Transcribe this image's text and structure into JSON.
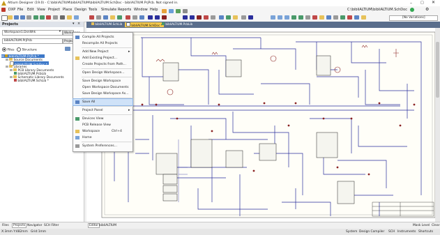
{
  "window": {
    "title": "Altium Designer (19.0) - C:\\bibliALTIUM\\bibliALTIUM\\bibliALTIUM.SchDoc - bibliALTIUM.PrjPcb. Not signed in.",
    "path_readout": "C:\\bibliALTIUM\\bibliALTIUM.SchDoc",
    "variations": "[No Variations]"
  },
  "menubar": {
    "items": [
      "DXP",
      "File",
      "Edit",
      "View",
      "Project",
      "Place",
      "Design",
      "Tools",
      "Simulate",
      "Reports",
      "Window",
      "Help"
    ]
  },
  "projects_panel": {
    "title": "Projects",
    "workspace_value": "Workspace1.DsnWrk",
    "workspace_button": "Workspace",
    "project_value": "bibliALTIUM.PrjPcb",
    "project_button": "Project",
    "radio_files": "Files",
    "radio_structure": "Structure",
    "tree": [
      {
        "label": "bibliALTIUM.PrjPcb *",
        "level": 0,
        "selected": true
      },
      {
        "label": "Source Documents",
        "level": 1,
        "selected": false
      },
      {
        "label": "bibliALTIUM.SchDoc *",
        "level": 2,
        "selected": true
      },
      {
        "label": "Libraries",
        "level": 1,
        "selected": false
      },
      {
        "label": "PCB Library Documents",
        "level": 2,
        "selected": false
      },
      {
        "label": "bibliALTIUM.PcbLib",
        "level": 3,
        "selected": false
      },
      {
        "label": "Schematic Library Documents",
        "level": 2,
        "selected": false
      },
      {
        "label": "bibliALTIUM.SchLib *",
        "level": 3,
        "selected": false
      }
    ]
  },
  "document_tabs": [
    {
      "label": "bibliALTIUM.SchLib",
      "active": false
    },
    {
      "label": "bibliALTIUM.SchDoc *",
      "active": true
    },
    {
      "label": "bibliALTIUM.PcbLib",
      "active": false
    }
  ],
  "context_menu": {
    "items": [
      {
        "label": "Compile All Projects",
        "icon": "compile-icon",
        "shortcut": "",
        "submenu": false
      },
      {
        "label": "Recompile All Projects",
        "icon": "",
        "shortcut": "",
        "submenu": false
      },
      {
        "sep": true
      },
      {
        "label": "Add New Project",
        "icon": "",
        "shortcut": "",
        "submenu": true
      },
      {
        "label": "Add Existing Project...",
        "icon": "folder-icon",
        "shortcut": "",
        "submenu": false
      },
      {
        "label": "Create Projects from Path...",
        "icon": "",
        "shortcut": "",
        "submenu": false
      },
      {
        "sep": true
      },
      {
        "label": "Open Design Workspace...",
        "icon": "",
        "shortcut": "",
        "submenu": false
      },
      {
        "sep": true
      },
      {
        "label": "Save Design Workspace",
        "icon": "",
        "shortcut": "",
        "submenu": false
      },
      {
        "label": "Open Workspace Documents",
        "icon": "",
        "shortcut": "",
        "submenu": false
      },
      {
        "label": "Save Design Workspace As...",
        "icon": "",
        "shortcut": "",
        "submenu": false
      },
      {
        "sep": true
      },
      {
        "label": "Save All",
        "icon": "save-all-icon",
        "shortcut": "",
        "submenu": false,
        "highlight": true
      },
      {
        "sep": true
      },
      {
        "label": "Project Panel",
        "icon": "",
        "shortcut": "",
        "submenu": true
      },
      {
        "sep": true
      },
      {
        "label": "Devices View",
        "icon": "devices-icon",
        "shortcut": "",
        "submenu": false
      },
      {
        "label": "PCB Release View",
        "icon": "",
        "shortcut": "",
        "submenu": false
      },
      {
        "label": "Workspace",
        "icon": "workspace-icon",
        "shortcut": "Ctrl+4",
        "submenu": false
      },
      {
        "label": "Home",
        "icon": "home-icon",
        "shortcut": "",
        "submenu": false
      },
      {
        "sep": true
      },
      {
        "label": "System Preferences...",
        "icon": "preferences-icon",
        "shortcut": "",
        "submenu": false
      }
    ]
  },
  "bottom_panel_tabs": [
    "Files",
    "Projects",
    "Navigator",
    "SCH Filter"
  ],
  "editor_tabs": [
    "Editor",
    "bibliALTIUM"
  ],
  "statusbar": {
    "coords": "X:3mm Y:482mm",
    "grid": "Grid:1mm",
    "right_items": [
      "System",
      "Design Compiler",
      "SCH",
      "Instruments",
      "Shortcuts"
    ]
  },
  "mask_level": "Mask Level",
  "clear_button": "Clear",
  "colors": {
    "wire": "#2b2f9c",
    "component": "#8a2222",
    "tab_bar": "#5a6e8c",
    "selection": "#3d78c8",
    "menu_highlight": "#cfe2f8"
  }
}
